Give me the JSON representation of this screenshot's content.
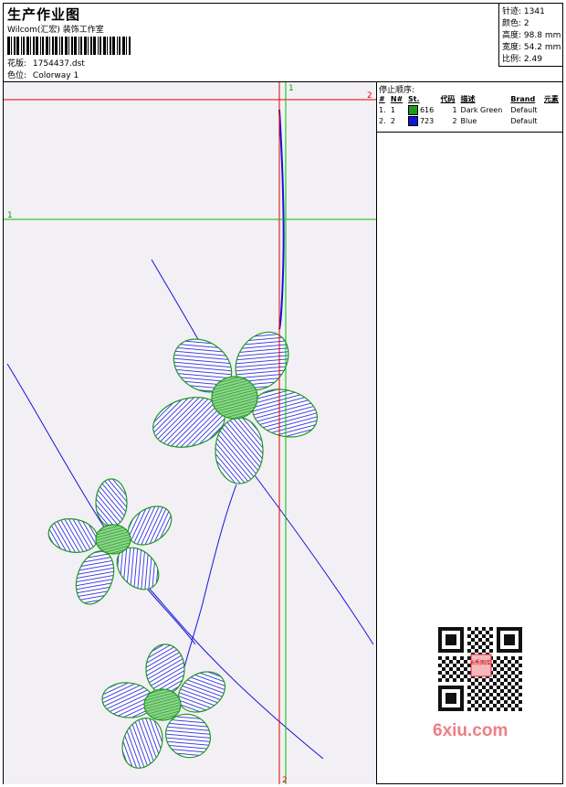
{
  "header": {
    "title": "生产作业图",
    "subtitle": "Wilcom(汇宏) 装饰工作室",
    "design_label": "花版:",
    "design_value": "1754437.dst",
    "colorway_label": "色位:",
    "colorway_value": "Colorway 1"
  },
  "stats": [
    {
      "label": "针迹:",
      "value": "1341"
    },
    {
      "label": "颜色:",
      "value": "2"
    },
    {
      "label": "高度:",
      "value": "98.8 mm"
    },
    {
      "label": "宽度:",
      "value": "54.2 mm"
    },
    {
      "label": "比例:",
      "value": "2.49"
    }
  ],
  "panel": {
    "heading": "停止顺序:",
    "columns": [
      "#",
      "N#",
      "St.",
      "代码",
      "描述",
      "Brand",
      "元素"
    ],
    "rows": [
      {
        "idx": "1.",
        "n": "1",
        "swatch": "#1d9a1d",
        "st": "616",
        "code": "1",
        "desc": "Dark Green",
        "brand": "Default"
      },
      {
        "idx": "2.",
        "n": "2",
        "swatch": "#1414d8",
        "st": "723",
        "code": "2",
        "desc": "Blue",
        "brand": "Default"
      }
    ]
  },
  "markers": {
    "red_h": "2",
    "green_h": "1",
    "green_v": "1",
    "red_v_bottom": "2"
  },
  "colors": {
    "outline": "#1d9a1d",
    "fill": "#1414d8",
    "red_guide": "#e00000",
    "green_guide": "#00c000"
  },
  "watermark": {
    "text": "6xiu.com",
    "badge": "6秀图库"
  }
}
